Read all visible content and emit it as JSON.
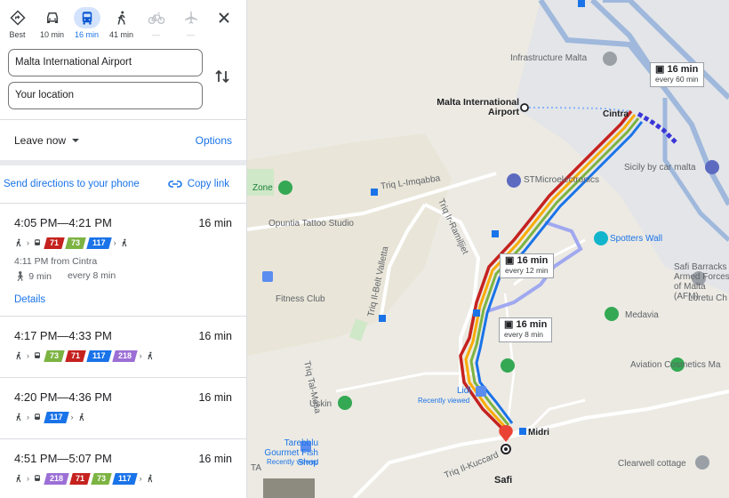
{
  "modes": [
    {
      "name": "best",
      "label": "Best",
      "icon": "diamond-directions-icon"
    },
    {
      "name": "driving",
      "label": "10 min",
      "icon": "car-icon"
    },
    {
      "name": "transit",
      "label": "16 min",
      "icon": "bus-icon",
      "active": true
    },
    {
      "name": "walking",
      "label": "41 min",
      "icon": "walk-icon"
    },
    {
      "name": "cycling",
      "label": "—",
      "icon": "bike-icon"
    },
    {
      "name": "flight",
      "label": "—",
      "icon": "plane-icon"
    }
  ],
  "origin": {
    "value": "Malta International Airport"
  },
  "destination": {
    "value": "Your location"
  },
  "leave": {
    "label": "Leave now",
    "options": "Options"
  },
  "share": {
    "send": "Send directions to your phone",
    "copy": "Copy link"
  },
  "routes": [
    {
      "time": "4:05 PM—4:21 PM",
      "duration": "16 min",
      "badges": [
        {
          "text": "71",
          "color": "#c5221f"
        },
        {
          "text": "73",
          "color": "#7cb342"
        },
        {
          "text": "117",
          "color": "#1a73e8"
        }
      ],
      "from": "4:11 PM from Cintra",
      "walk": "9 min",
      "freq": "every 8 min",
      "details": "Details"
    },
    {
      "time": "4:17 PM—4:33 PM",
      "duration": "16 min",
      "badges": [
        {
          "text": "73",
          "color": "#7cb342"
        },
        {
          "text": "71",
          "color": "#c5221f"
        },
        {
          "text": "117",
          "color": "#1a73e8"
        },
        {
          "text": "218",
          "color": "#9c6fd6"
        }
      ]
    },
    {
      "time": "4:20 PM—4:36 PM",
      "duration": "16 min",
      "badges": [
        {
          "text": "117",
          "color": "#1a73e8"
        }
      ]
    },
    {
      "time": "4:51 PM—5:07 PM",
      "duration": "16 min",
      "badges": [
        {
          "text": "218",
          "color": "#9c6fd6"
        },
        {
          "text": "71",
          "color": "#c5221f"
        },
        {
          "text": "73",
          "color": "#7cb342"
        },
        {
          "text": "117",
          "color": "#1a73e8"
        }
      ]
    }
  ],
  "map": {
    "labels": {
      "infrastructure": "Infrastructure Malta",
      "airport": "Malta International Airport",
      "cintra": "Cintra",
      "sicily": "Sicily by car malta",
      "zone": "Zone",
      "imqabba": "Triq L-Imqabba",
      "rampjt": "Triq Ir-Ramiljiet",
      "stmicro": "STMicroelectronics",
      "opuntia": "Opuntia Tattoo Studio",
      "valletta": "Triq Il-Belt Valletta",
      "spotters": "Spotters Wall",
      "safi_barracks": "Safi Barracks Armed Forces of Malta (AFM)",
      "fitness": "Fitness Club",
      "medavia": "Medavia",
      "loretu": "Loretu Ch",
      "taflew": "Triq Tal-Mesa",
      "lidl": "Lidl",
      "recently1": "Recently viewed",
      "aviation": "Aviation Cosmetics Ma",
      "uskin": "Uskin",
      "midri": "Midri",
      "kuccard": "Triq Il-Kuccard",
      "gourmet": "Tarebblu Gourmet Fish Shop",
      "recently2": "Recently viewed",
      "clearwell": "Clearwell cottage",
      "safi": "Safi",
      "ta": "TA"
    },
    "callouts": [
      {
        "time": "16 min",
        "freq": "every 60 min"
      },
      {
        "time": "16 min",
        "freq": "every 12 min"
      },
      {
        "time": "16 min",
        "freq": "every 8 min"
      }
    ]
  }
}
